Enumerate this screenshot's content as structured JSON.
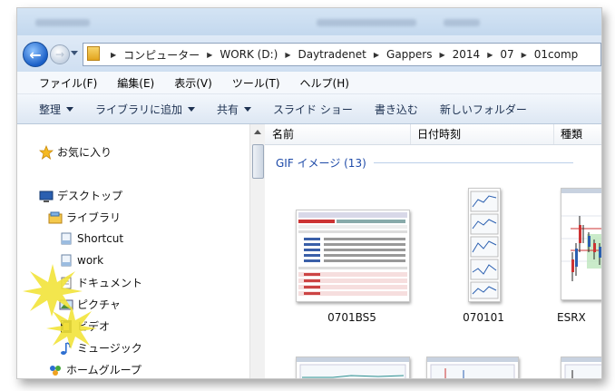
{
  "address": {
    "crumbs": [
      "コンピューター",
      "WORK (D:)",
      "Daytradenet",
      "Gappers",
      "2014",
      "07",
      "01comp"
    ]
  },
  "menu": {
    "items": [
      "ファイル(F)",
      "編集(E)",
      "表示(V)",
      "ツール(T)",
      "ヘルプ(H)"
    ]
  },
  "toolbar": {
    "organize": "整理",
    "include_library": "ライブラリに追加",
    "share": "共有",
    "slideshow": "スライド ショー",
    "burn": "書き込む",
    "new_folder": "新しいフォルダー"
  },
  "nav": {
    "favorites": "お気に入り",
    "desktop": "デスクトップ",
    "libraries": "ライブラリ",
    "shortcut": "Shortcut",
    "work": "work",
    "documents": "ドキュメント",
    "pictures": "ピクチャ",
    "videos": "ビデオ",
    "music": "ミュージック",
    "homegroup": "ホームグループ"
  },
  "columns": {
    "name": "名前",
    "date": "日付時刻",
    "type": "種類"
  },
  "group": {
    "label": "GIF イメージ (13)"
  },
  "files": [
    {
      "name": "0701BS5"
    },
    {
      "name": "070101"
    },
    {
      "name": "ESRX"
    }
  ],
  "colors": {
    "accent_blue": "#1e4aa8",
    "header_bg": "#dfeaf7",
    "sparkle": "#f2e33a"
  }
}
